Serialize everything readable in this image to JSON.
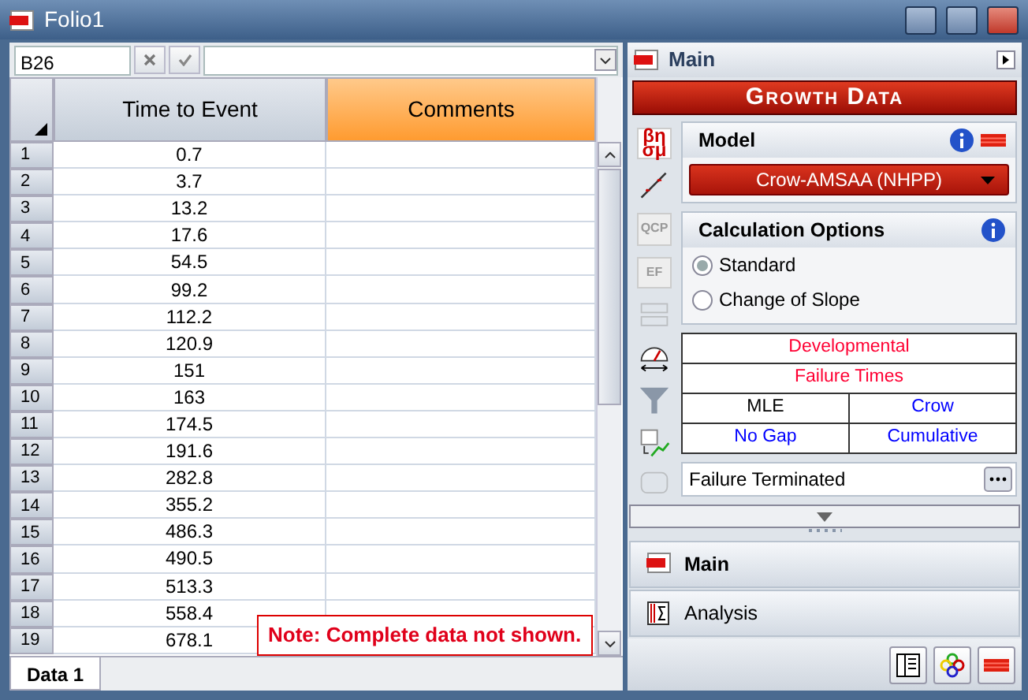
{
  "window": {
    "title": "Folio1"
  },
  "formula_bar": {
    "cell_ref": "B26"
  },
  "grid": {
    "columns": [
      {
        "label": "Time to Event",
        "selected": false
      },
      {
        "label": "Comments",
        "selected": true
      }
    ],
    "rows": [
      {
        "number": "1",
        "time": "0.7"
      },
      {
        "number": "2",
        "time": "3.7"
      },
      {
        "number": "3",
        "time": "13.2"
      },
      {
        "number": "4",
        "time": "17.6"
      },
      {
        "number": "5",
        "time": "54.5"
      },
      {
        "number": "6",
        "time": "99.2"
      },
      {
        "number": "7",
        "time": "112.2"
      },
      {
        "number": "8",
        "time": "120.9"
      },
      {
        "number": "9",
        "time": "151"
      },
      {
        "number": "10",
        "time": "163"
      },
      {
        "number": "11",
        "time": "174.5"
      },
      {
        "number": "12",
        "time": "191.6"
      },
      {
        "number": "13",
        "time": "282.8"
      },
      {
        "number": "14",
        "time": "355.2"
      },
      {
        "number": "15",
        "time": "486.3"
      },
      {
        "number": "16",
        "time": "490.5"
      },
      {
        "number": "17",
        "time": "513.3"
      },
      {
        "number": "18",
        "time": "558.4"
      },
      {
        "number": "19",
        "time": "678.1"
      }
    ]
  },
  "note": "Note: Complete data not shown.",
  "sheet_tabs": [
    {
      "label": "Data 1",
      "selected": true
    }
  ],
  "panel": {
    "header": "Main",
    "banner": "Growth Data",
    "tools": [
      {
        "kind": "params",
        "label": "βη σμ",
        "disabled": false
      },
      {
        "kind": "plot",
        "disabled": false
      },
      {
        "kind": "text",
        "label": "QCP",
        "disabled": true
      },
      {
        "kind": "text",
        "label": "EF",
        "disabled": true
      },
      {
        "kind": "convert",
        "disabled": true
      },
      {
        "kind": "gauge",
        "disabled": false
      },
      {
        "kind": "filter",
        "disabled": false
      },
      {
        "kind": "chart",
        "disabled": false
      },
      {
        "kind": "abc",
        "disabled": true
      }
    ],
    "model": {
      "title": "Model",
      "value": "Crow-AMSAA (NHPP)"
    },
    "calc_options": {
      "title": "Calculation Options",
      "options": [
        {
          "label": "Standard",
          "selected": true
        },
        {
          "label": "Change of Slope",
          "selected": false
        }
      ]
    },
    "summary": [
      [
        {
          "text": "Developmental",
          "color": "#ff0033"
        }
      ],
      [
        {
          "text": "Failure Times",
          "color": "#ff0033"
        }
      ],
      [
        {
          "text": "MLE",
          "color": "#000000"
        },
        {
          "text": "Crow",
          "color": "#0000ff"
        }
      ],
      [
        {
          "text": "No Gap",
          "color": "#0000ff"
        },
        {
          "text": "Cumulative",
          "color": "#0000ff"
        }
      ]
    ],
    "termination": "Failure Terminated",
    "nav": [
      {
        "label": "Main",
        "selected": true
      },
      {
        "label": "Analysis",
        "selected": false
      }
    ]
  }
}
